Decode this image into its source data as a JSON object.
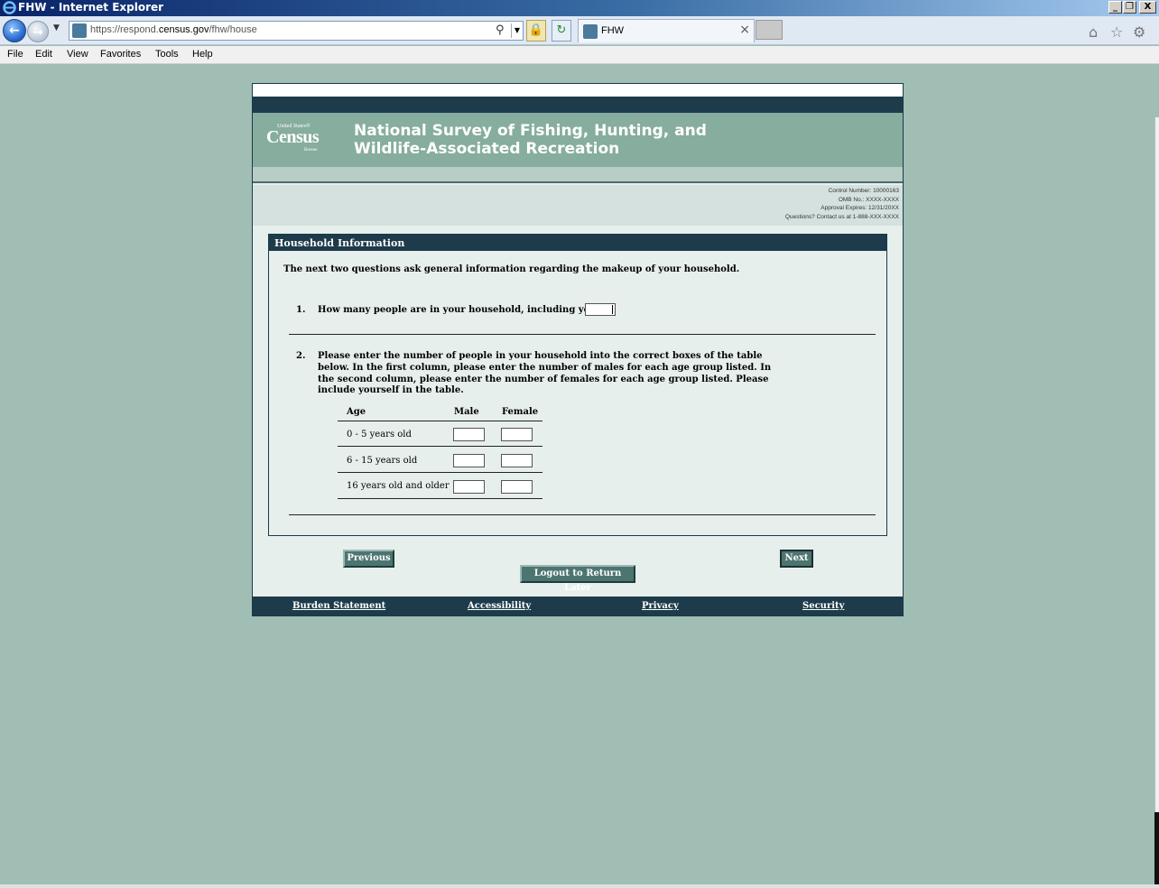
{
  "window": {
    "title": "FHW - Internet Explorer",
    "controls": [
      "_",
      "❐",
      "X"
    ]
  },
  "browser": {
    "url_prefix": "https://respond.",
    "url_domain": "census.gov",
    "url_path": "/fhw/house",
    "tab_label": "FHW",
    "tab_close": "×"
  },
  "menu": {
    "items": [
      "File",
      "Edit",
      "View",
      "Favorites",
      "Tools",
      "Help"
    ]
  },
  "header": {
    "logo_small": "United States®",
    "logo_word": "Census",
    "logo_bureau": "Bureau",
    "title": "National Survey of Fishing, Hunting, and Wildlife-Associated Recreation",
    "meta": [
      "Control Number: 10000163",
      "OMB No.: XXXX-XXXX",
      "Approval Expires: 12/31/20XX",
      "Questions? Contact us at 1-888-XXX-XXXX"
    ]
  },
  "section": {
    "heading": "Household Information",
    "intro": "The next two questions ask general information regarding the makeup of your household.",
    "q1": {
      "number": "1.",
      "text": "How many people are in your household, including you?",
      "value": ""
    },
    "q2": {
      "number": "2.",
      "lines": [
        "Please enter the number of people in your household into the correct boxes of the table",
        "below. In the first column, please enter the number of males for each age group listed. In",
        "the second column, please enter the number of females for each age group listed. Please",
        "include yourself in the table."
      ]
    },
    "table": {
      "headers": [
        "Age",
        "Male",
        "Female"
      ],
      "rows": [
        {
          "label": "0 - 5 years old",
          "male": "",
          "female": ""
        },
        {
          "label": "6 - 15 years old",
          "male": "",
          "female": ""
        },
        {
          "label": "16 years old and older",
          "male": "",
          "female": ""
        }
      ]
    }
  },
  "buttons": {
    "previous": "Previous",
    "next": "Next",
    "logout": "Logout to Return Later"
  },
  "footer": {
    "links": [
      "Burden Statement",
      "Accessibility",
      "Privacy",
      "Security"
    ]
  },
  "colors": {
    "page_background": "#a0beb3",
    "banner": "#86ad9e",
    "dark_band": "#1d3b4a",
    "button": "#4d7570"
  }
}
